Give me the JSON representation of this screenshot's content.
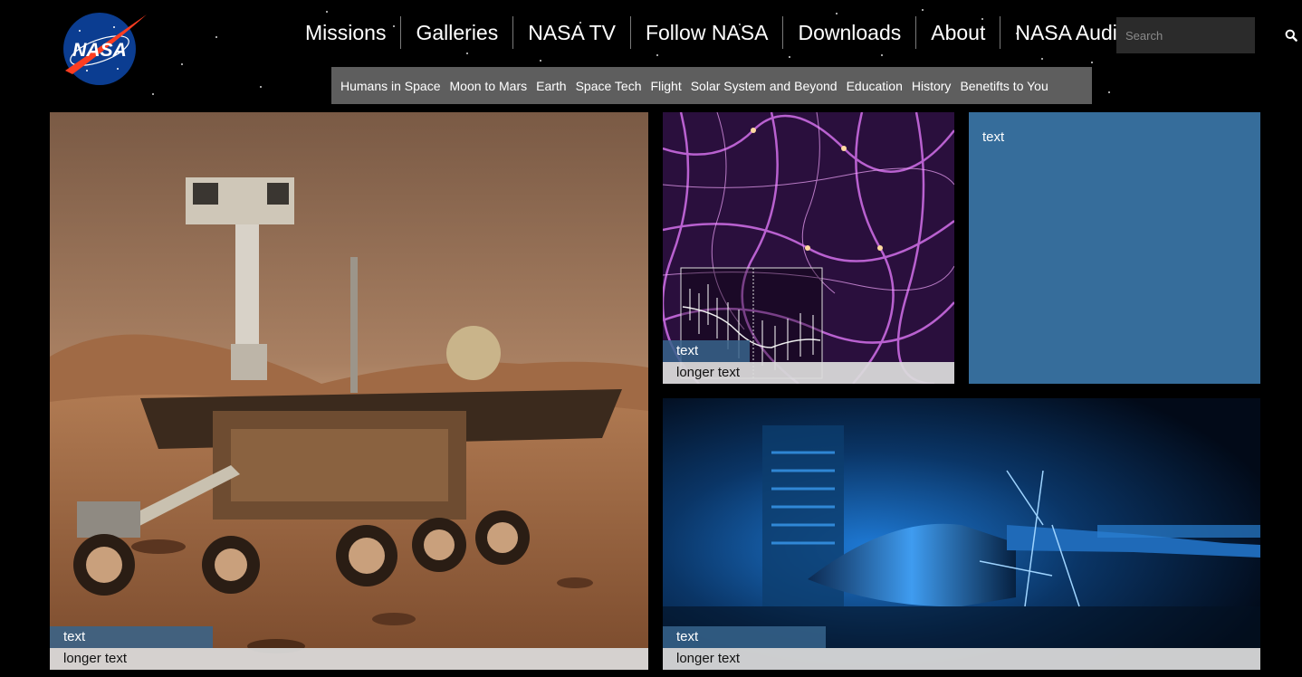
{
  "header": {
    "logo_text": "NASA",
    "nav": [
      "Missions",
      "Galleries",
      "NASA TV",
      "Follow NASA",
      "Downloads",
      "About",
      "NASA Audiences"
    ],
    "search": {
      "placeholder": "Search"
    },
    "subnav": [
      "Humans in Space",
      "Moon to Mars",
      "Earth",
      "Space Tech",
      "Flight",
      "Solar System and Beyond",
      "Education",
      "History",
      "Benetifts to You"
    ]
  },
  "tiles": {
    "rover": {
      "tag": "text",
      "caption": "longer text"
    },
    "cosmic_web": {
      "tag": "text",
      "caption": "longer text"
    },
    "text_panel": {
      "label": "text"
    },
    "wind_tunnel": {
      "tag": "text",
      "caption": "longer text"
    }
  },
  "colors": {
    "background": "#000000",
    "subnav_bg": "#5e5e5e",
    "tag_blue": "#37648c",
    "panel_blue": "#366d9b",
    "caption_bg": "#dcdcdc",
    "nasa_blue": "#0b3d91",
    "nasa_red": "#fc3d21"
  },
  "icons": {
    "search": "search-icon",
    "logo": "nasa-meatball-logo"
  }
}
